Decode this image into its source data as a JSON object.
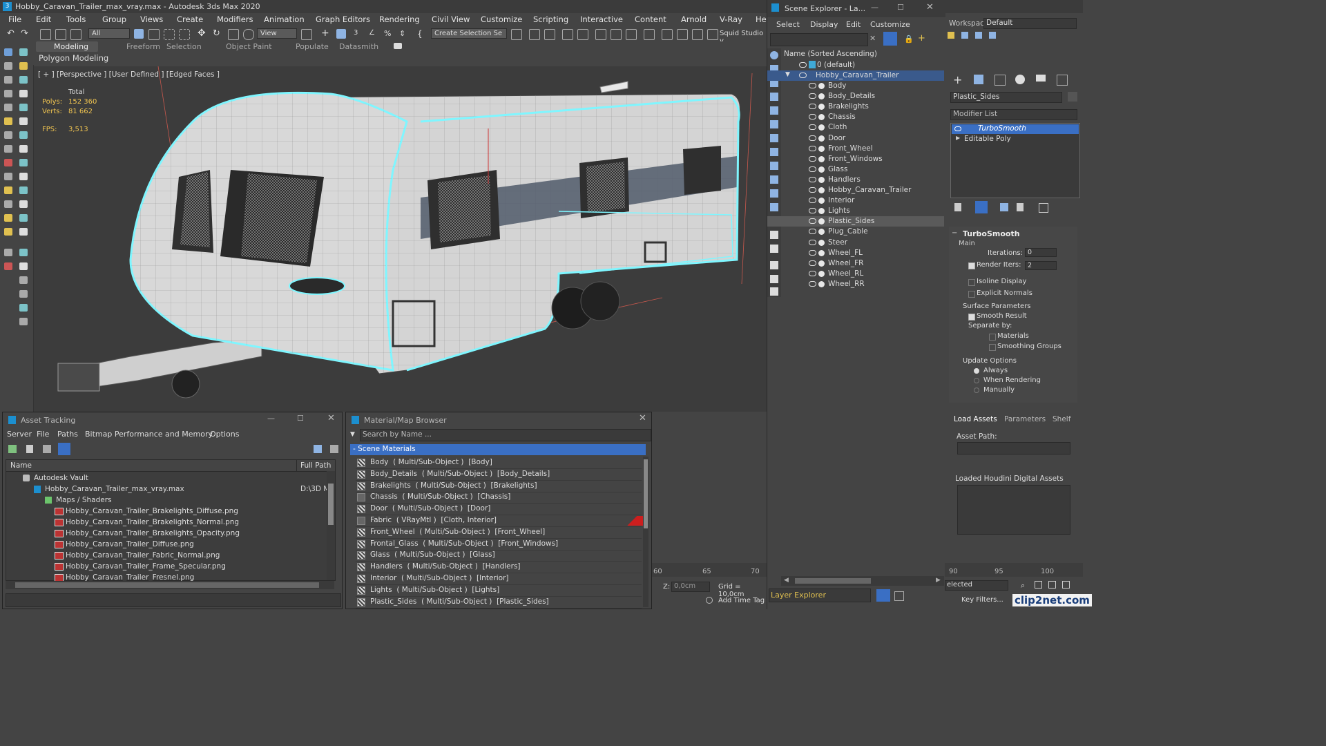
{
  "app": {
    "title": "Hobby_Caravan_Trailer_max_vray.max - Autodesk 3ds Max 2020",
    "workspace_label": "Workspaces:",
    "workspace_value": "Default"
  },
  "menu": [
    "File",
    "Edit",
    "Tools",
    "Group",
    "Views",
    "Create",
    "Modifiers",
    "Animation",
    "Graph Editors",
    "Rendering",
    "Civil View",
    "Customize",
    "Scripting",
    "Interactive",
    "Content",
    "Arnold",
    "V-Ray",
    "He"
  ],
  "toolbar": {
    "filter_value": "All",
    "view_value": "View",
    "selection_set": "Create Selection Se",
    "squid": "Squid Studio v"
  },
  "ribbon": {
    "tabs": [
      "Modeling",
      "Freeform",
      "Selection",
      "Object Paint",
      "Populate",
      "Datasmith"
    ],
    "subtab": "Polygon Modeling"
  },
  "viewport": {
    "label": "[ + ] [Perspective ] [User Defined ] [Edged Faces ]",
    "stats": {
      "total_label": "Total",
      "polys_label": "Polys:",
      "polys_value": "152 360",
      "verts_label": "Verts:",
      "verts_value": "81 662",
      "fps_label": "FPS:",
      "fps_value": "3,513"
    }
  },
  "scene_explorer": {
    "title": "Scene Explorer - La...",
    "menus": [
      "Select",
      "Display",
      "Edit",
      "Customize"
    ],
    "column_header": "Name (Sorted Ascending)",
    "layer_default": "0 (default)",
    "root_object": "Hobby_Caravan_Trailer",
    "objects": [
      "Body",
      "Body_Details",
      "Brakelights",
      "Chassis",
      "Cloth",
      "Door",
      "Front_Wheel",
      "Front_Windows",
      "Glass",
      "Handlers",
      "Hobby_Caravan_Trailer",
      "Interior",
      "Lights",
      "Plastic_Sides",
      "Plug_Cable",
      "Steer",
      "Wheel_FL",
      "Wheel_FR",
      "Wheel_RL",
      "Wheel_RR"
    ],
    "selected_object": "Plastic_Sides",
    "footer_label": "Layer Explorer"
  },
  "command_panel": {
    "object_name": "Plastic_Sides",
    "modifier_list_label": "Modifier List",
    "modifiers": [
      "TurboSmooth",
      "Editable Poly"
    ],
    "turbosmooth": {
      "title": "TurboSmooth",
      "main_label": "Main",
      "iterations_label": "Iterations:",
      "iterations_value": "0",
      "render_iters_label": "Render Iters:",
      "render_iters_value": "2",
      "isoline_label": "Isoline Display",
      "explicit_normals_label": "Explicit Normals",
      "surface_params_label": "Surface Parameters",
      "smooth_result_label": "Smooth Result",
      "separate_by_label": "Separate by:",
      "materials_label": "Materials",
      "smoothing_groups_label": "Smoothing Groups",
      "update_options_label": "Update Options",
      "always_label": "Always",
      "when_rendering_label": "When Rendering",
      "manually_label": "Manually"
    },
    "tabs": [
      "Load Assets",
      "Parameters",
      "Shelf"
    ],
    "asset_path_label": "Asset Path:",
    "loaded_houdini_label": "Loaded Houdini Digital Assets"
  },
  "asset_tracking": {
    "title": "Asset Tracking",
    "menus": [
      "Server",
      "File",
      "Paths",
      "Bitmap Performance and Memory",
      "Options"
    ],
    "col_name": "Name",
    "col_path": "Full Path",
    "vault": "Autodesk Vault",
    "max_file": "Hobby_Caravan_Trailer_max_vray.max",
    "max_file_path": "D:\\3D Mo",
    "maps_label": "Maps / Shaders",
    "maps": [
      "Hobby_Caravan_Trailer_Brakelights_Diffuse.png",
      "Hobby_Caravan_Trailer_Brakelights_Normal.png",
      "Hobby_Caravan_Trailer_Brakelights_Opacity.png",
      "Hobby_Caravan_Trailer_Diffuse.png",
      "Hobby_Caravan_Trailer_Fabric_Normal.png",
      "Hobby_Caravan_Trailer_Frame_Specular.png",
      "Hobby_Caravan_Trailer_Fresnel.png"
    ]
  },
  "material_browser": {
    "title": "Material/Map Browser",
    "search_placeholder": "Search by Name ...",
    "group_label": "- Scene Materials",
    "materials": [
      "Body  ( Multi/Sub-Object )  [Body]",
      "Body_Details  ( Multi/Sub-Object )  [Body_Details]",
      "Brakelights  ( Multi/Sub-Object )  [Brakelights]",
      "Chassis  ( Multi/Sub-Object )  [Chassis]",
      "Door  ( Multi/Sub-Object )  [Door]",
      "Fabric  ( VRayMtl )  [Cloth, Interior]",
      "Front_Wheel  ( Multi/Sub-Object )  [Front_Wheel]",
      "Frontal_Glass  ( Multi/Sub-Object )  [Front_Windows]",
      "Glass  ( Multi/Sub-Object )  [Glass]",
      "Handlers  ( Multi/Sub-Object )  [Handlers]",
      "Interior  ( Multi/Sub-Object )  [Interior]",
      "Lights  ( Multi/Sub-Object )  [Lights]",
      "Plastic_Sides  ( Multi/Sub-Object )  [Plastic_Sides]"
    ]
  },
  "timeline": {
    "ticks_left": [
      "60",
      "65",
      "70"
    ],
    "ticks_right": [
      "90",
      "95",
      "100"
    ],
    "z_label": "Z:",
    "z_value": "0,0cm",
    "grid_label": "Grid = 10,0cm",
    "add_time_tag": "Add Time Tag",
    "selected_label": "elected",
    "key_filters": "Key Filters..."
  },
  "watermark": "clip2net.com",
  "colors": {
    "accent_blue": "#3a6fc4",
    "selection_cyan": "#7ff6ff",
    "stats_yellow": "#f0c450",
    "panel_bg": "#444444"
  }
}
